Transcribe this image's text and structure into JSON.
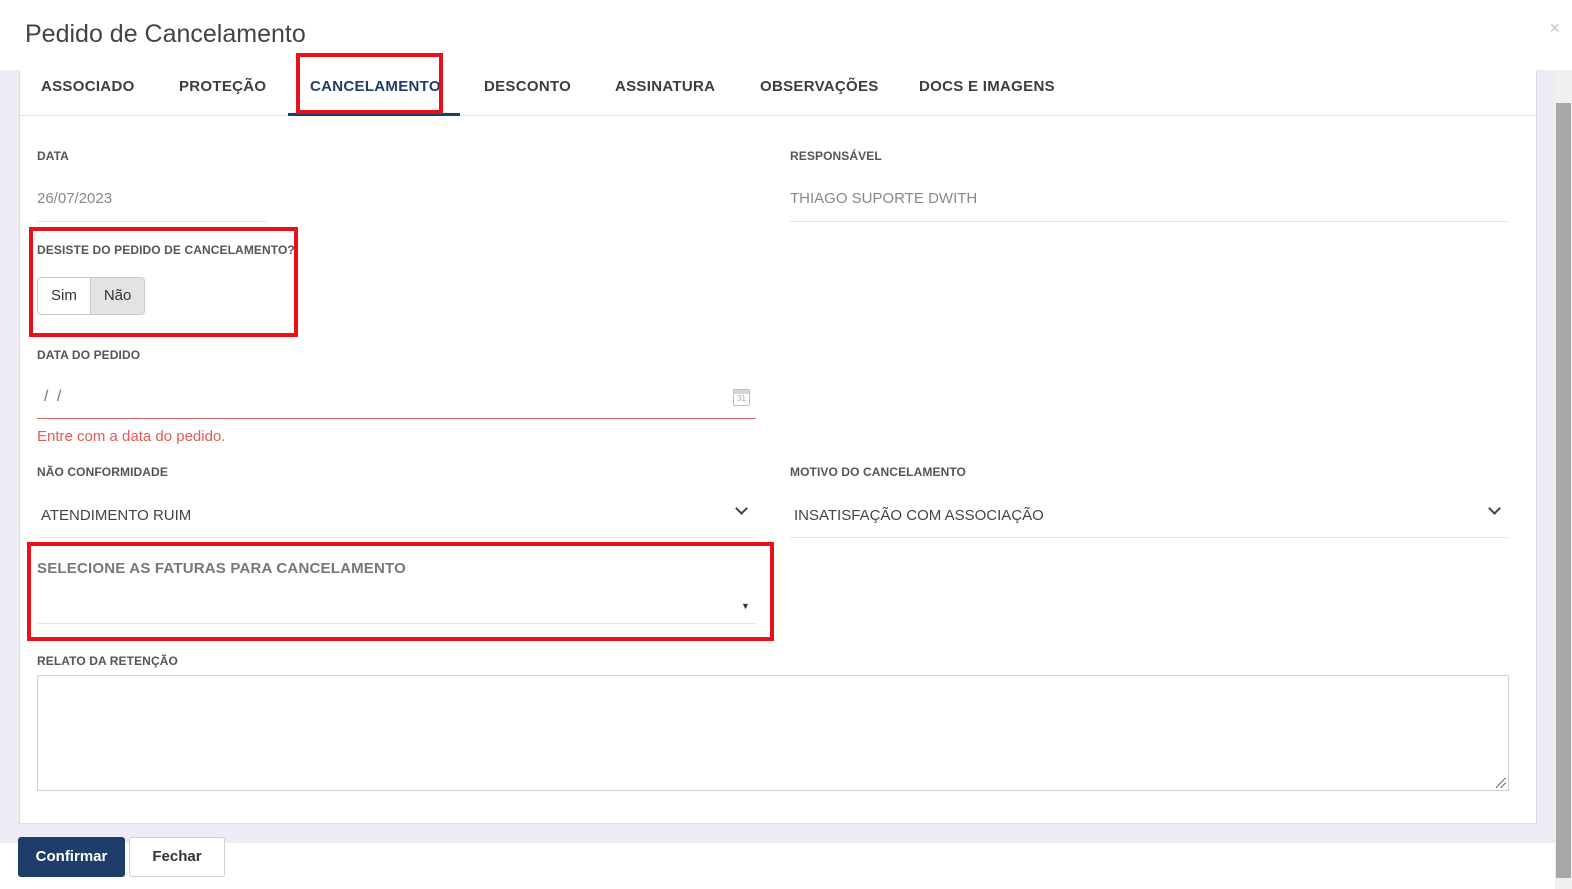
{
  "modal": {
    "title": "Pedido de Cancelamento",
    "close_glyph": "×"
  },
  "tabs": [
    {
      "label": "ASSOCIADO"
    },
    {
      "label": "PROTEÇÃO"
    },
    {
      "label": "CANCELAMENTO",
      "active": true
    },
    {
      "label": "DESCONTO"
    },
    {
      "label": "ASSINATURA"
    },
    {
      "label": "OBSERVAÇÕES"
    },
    {
      "label": "DOCS E IMAGENS"
    }
  ],
  "form": {
    "data_label": "DATA",
    "data_value": "26/07/2023",
    "responsavel_label": "RESPONSÁVEL",
    "responsavel_value": "THIAGO SUPORTE DWITH",
    "desiste_label": "DESISTE DO PEDIDO DE CANCELAMENTO?",
    "desiste_options": [
      "Sim",
      "Não"
    ],
    "desiste_selected": "Não",
    "data_pedido_label": "DATA DO PEDIDO",
    "data_pedido_value": "/ /",
    "data_pedido_error": "Entre com a data do pedido.",
    "calendar_icon_text": "31",
    "nao_conformidade_label": "NÃO CONFORMIDADE",
    "nao_conformidade_value": "ATENDIMENTO RUIM",
    "motivo_label": "MOTIVO DO CANCELAMENTO",
    "motivo_value": "INSATISFAÇÃO COM ASSOCIAÇÃO",
    "faturas_label": "SELECIONE AS FATURAS PARA CANCELAMENTO",
    "faturas_caret": "▼",
    "relato_label": "RELATO DA RETENÇÃO"
  },
  "footer": {
    "confirm_label": "Confirmar",
    "close_label": "Fechar"
  },
  "colors": {
    "primary": "#1e3d6b",
    "error": "#e55a5a",
    "highlight": "#e8101a"
  }
}
